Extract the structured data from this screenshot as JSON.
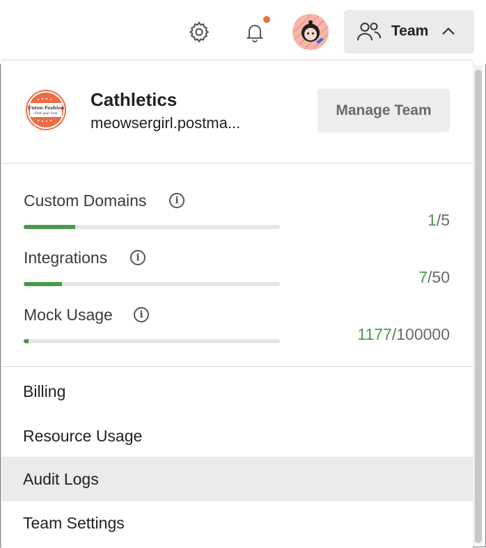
{
  "header": {
    "icons": {
      "settings": "gear-icon",
      "notifications": "bell-icon",
      "team": "people-icon",
      "chevron": "chevron-up-icon"
    },
    "notification_dot_color": "#e8703f",
    "team_button_label": "Team"
  },
  "team": {
    "name": "Cathletics",
    "email": "meowsergirl.postma...",
    "logo_text": "Union Fashion",
    "logo_subtext": "Find your look",
    "manage_label": "Manage Team"
  },
  "usage": [
    {
      "label": "Custom Domains",
      "used": "1",
      "total": "/5",
      "fraction": 0.2
    },
    {
      "label": "Integrations",
      "used": "7",
      "total": "/50",
      "fraction": 0.15
    },
    {
      "label": "Mock Usage",
      "used": "1177",
      "total": "/100000",
      "fraction": 0.02
    }
  ],
  "menu": [
    {
      "label": "Billing"
    },
    {
      "label": "Resource Usage"
    },
    {
      "label": "Audit Logs"
    },
    {
      "label": "Team Settings"
    }
  ],
  "colors": {
    "accent_green": "#4b9a4b",
    "logo_orange": "#ec6d45"
  }
}
